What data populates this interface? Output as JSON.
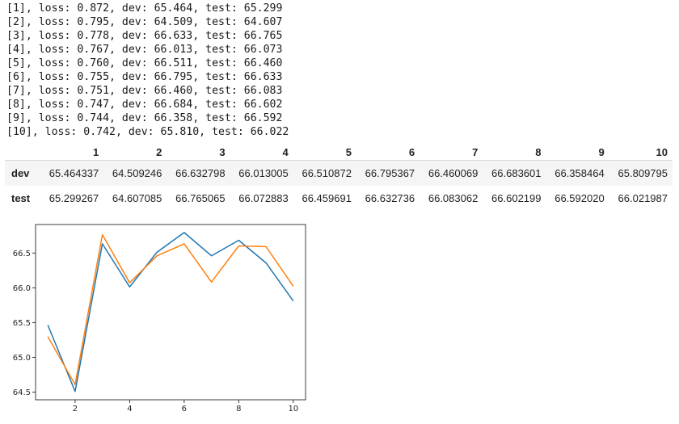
{
  "log_lines": [
    "[1], loss: 0.872, dev: 65.464, test: 65.299",
    "[2], loss: 0.795, dev: 64.509, test: 64.607",
    "[3], loss: 0.778, dev: 66.633, test: 66.765",
    "[4], loss: 0.767, dev: 66.013, test: 66.073",
    "[5], loss: 0.760, dev: 66.511, test: 66.460",
    "[6], loss: 0.755, dev: 66.795, test: 66.633",
    "[7], loss: 0.751, dev: 66.460, test: 66.083",
    "[8], loss: 0.747, dev: 66.684, test: 66.602",
    "[9], loss: 0.744, dev: 66.358, test: 66.592",
    "[10], loss: 0.742, dev: 65.810, test: 66.022"
  ],
  "table": {
    "columns": [
      "1",
      "2",
      "3",
      "4",
      "5",
      "6",
      "7",
      "8",
      "9",
      "10"
    ],
    "rows": [
      {
        "label": "dev",
        "values": [
          "65.464337",
          "64.509246",
          "66.632798",
          "66.013005",
          "66.510872",
          "66.795367",
          "66.460069",
          "66.683601",
          "66.358464",
          "65.809795"
        ]
      },
      {
        "label": "test",
        "values": [
          "65.299267",
          "64.607085",
          "66.765065",
          "66.072883",
          "66.459691",
          "66.632736",
          "66.083062",
          "66.602199",
          "66.592020",
          "66.021987"
        ]
      }
    ]
  },
  "chart_data": {
    "type": "line",
    "x": [
      1,
      2,
      3,
      4,
      5,
      6,
      7,
      8,
      9,
      10
    ],
    "series": [
      {
        "values": [
          65.464337,
          64.509246,
          66.632798,
          66.013005,
          66.510872,
          66.795367,
          66.460069,
          66.683601,
          66.358464,
          65.809795
        ],
        "color": "#1f77b4"
      },
      {
        "values": [
          65.299267,
          64.607085,
          66.765065,
          66.072883,
          66.459691,
          66.632736,
          66.083062,
          66.602199,
          66.59202,
          66.021987
        ],
        "color": "#ff7f0e"
      }
    ],
    "xticks": [
      2,
      4,
      6,
      8,
      10
    ],
    "yticks": [
      64.5,
      65.0,
      65.5,
      66.0,
      66.5
    ],
    "ytick_labels": [
      "64.5",
      "65.0",
      "65.5",
      "66.0",
      "66.5"
    ],
    "xlim": [
      0.55,
      10.45
    ],
    "ylim": [
      64.39,
      66.91
    ],
    "title": "",
    "xlabel": "",
    "ylabel": ""
  }
}
